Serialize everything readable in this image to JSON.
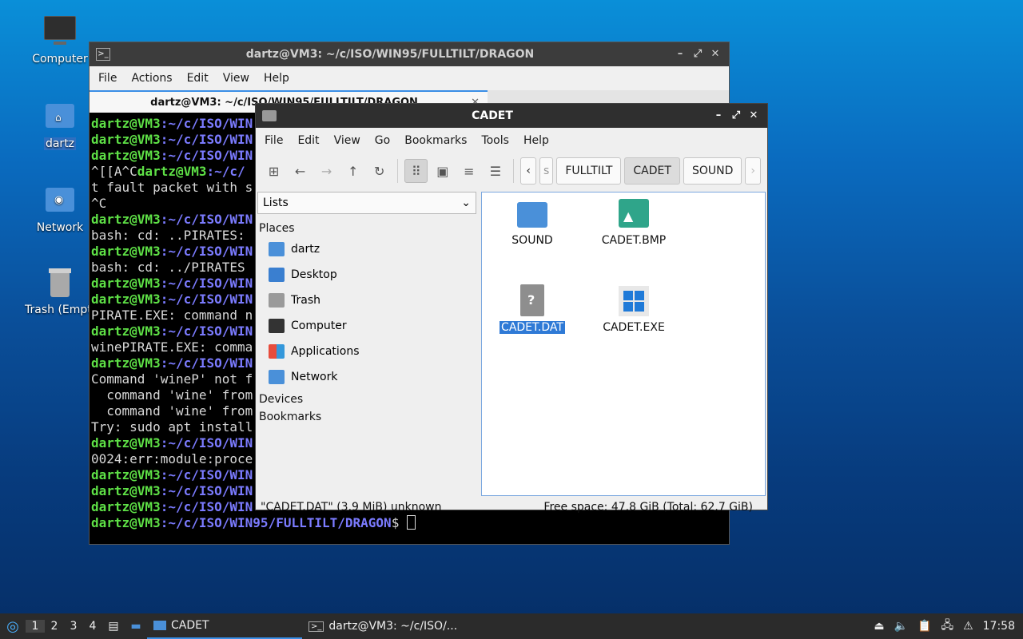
{
  "desktop": {
    "icons": [
      {
        "label": "Computer"
      },
      {
        "label": "dartz"
      },
      {
        "label": "Network"
      },
      {
        "label": "Trash (Empty)"
      }
    ]
  },
  "terminal": {
    "title": "dartz@VM3: ~/c/ISO/WIN95/FULLTILT/DRAGON",
    "menu": [
      "File",
      "Actions",
      "Edit",
      "View",
      "Help"
    ],
    "tab_title": "dartz@VM3: ~/c/ISO/WIN95/FULLTILT/DRAGON",
    "lines": [
      {
        "user": "dartz@VM3",
        "path": ":~/c/ISO/WIN",
        "rest": ""
      },
      {
        "user": "dartz@VM3",
        "path": ":~/c/ISO/WIN",
        "rest": ""
      },
      {
        "user": "dartz@VM3",
        "path": ":~/c/ISO/WIN",
        "rest": ""
      },
      {
        "text": "^[[A^C",
        "user": "dartz@VM3",
        "path": ":~/c/",
        "rest": ""
      },
      {
        "text": "t fault packet with s"
      },
      {
        "text": "^C"
      },
      {
        "user": "dartz@VM3",
        "path": ":~/c/ISO/WIN",
        "rest": ""
      },
      {
        "text": "bash: cd: ..PIRATES:"
      },
      {
        "user": "dartz@VM3",
        "path": ":~/c/ISO/WIN",
        "rest": ""
      },
      {
        "text": "bash: cd: ../PIRATES"
      },
      {
        "user": "dartz@VM3",
        "path": ":~/c/ISO/WIN",
        "rest": ""
      },
      {
        "user": "dartz@VM3",
        "path": ":~/c/ISO/WIN",
        "rest": ""
      },
      {
        "text": "PIRATE.EXE: command n"
      },
      {
        "user": "dartz@VM3",
        "path": ":~/c/ISO/WIN",
        "rest": ""
      },
      {
        "text": "winePIRATE.EXE: comma"
      },
      {
        "user": "dartz@VM3",
        "path": ":~/c/ISO/WIN",
        "rest": ""
      },
      {
        "text": "Command 'wineP' not f"
      },
      {
        "text": "  command 'wine' from"
      },
      {
        "text": "  command 'wine' from"
      },
      {
        "text": "Try: sudo apt install"
      },
      {
        "user": "dartz@VM3",
        "path": ":~/c/ISO/WIN",
        "rest": ""
      },
      {
        "text": "0024:err:module:proce"
      },
      {
        "user": "dartz@VM3",
        "path": ":~/c/ISO/WIN",
        "rest": ""
      },
      {
        "user": "dartz@VM3",
        "path": ":~/c/ISO/WIN",
        "rest": ""
      },
      {
        "user": "dartz@VM3",
        "path": ":~/c/ISO/WIN",
        "rest": ""
      },
      {
        "user": "dartz@VM3",
        "path": ":~/c/ISO/WIN95/FULLTILT/DRAGON",
        "rest": "$ "
      }
    ]
  },
  "filemanager": {
    "title": "CADET",
    "menu": [
      "File",
      "Edit",
      "View",
      "Go",
      "Bookmarks",
      "Tools",
      "Help"
    ],
    "breadcrumbs": [
      "FULLTILT",
      "CADET",
      "SOUND"
    ],
    "side_selector": "Lists",
    "places_heading": "Places",
    "places": [
      "dartz",
      "Desktop",
      "Trash",
      "Computer",
      "Applications",
      "Network"
    ],
    "devices_heading": "Devices",
    "bookmarks_heading": "Bookmarks",
    "files": [
      {
        "name": "SOUND",
        "icon": "folder-icon"
      },
      {
        "name": "CADET.BMP",
        "icon": "image-icon"
      },
      {
        "name": "CADET.DAT",
        "icon": "unknown-file-icon",
        "selected": true
      },
      {
        "name": "CADET.EXE",
        "icon": "windows-exe-icon"
      }
    ],
    "status_left": "\"CADET.DAT\" (3.9 MiB) unknown",
    "status_right": "Free space: 47.8 GiB (Total: 62.7 GiB)"
  },
  "taskbar": {
    "workspaces": [
      "1",
      "2",
      "3",
      "4"
    ],
    "tasks": [
      {
        "label": "CADET"
      },
      {
        "label": "dartz@VM3: ~/c/ISO/..."
      }
    ],
    "clock": "17:58"
  }
}
